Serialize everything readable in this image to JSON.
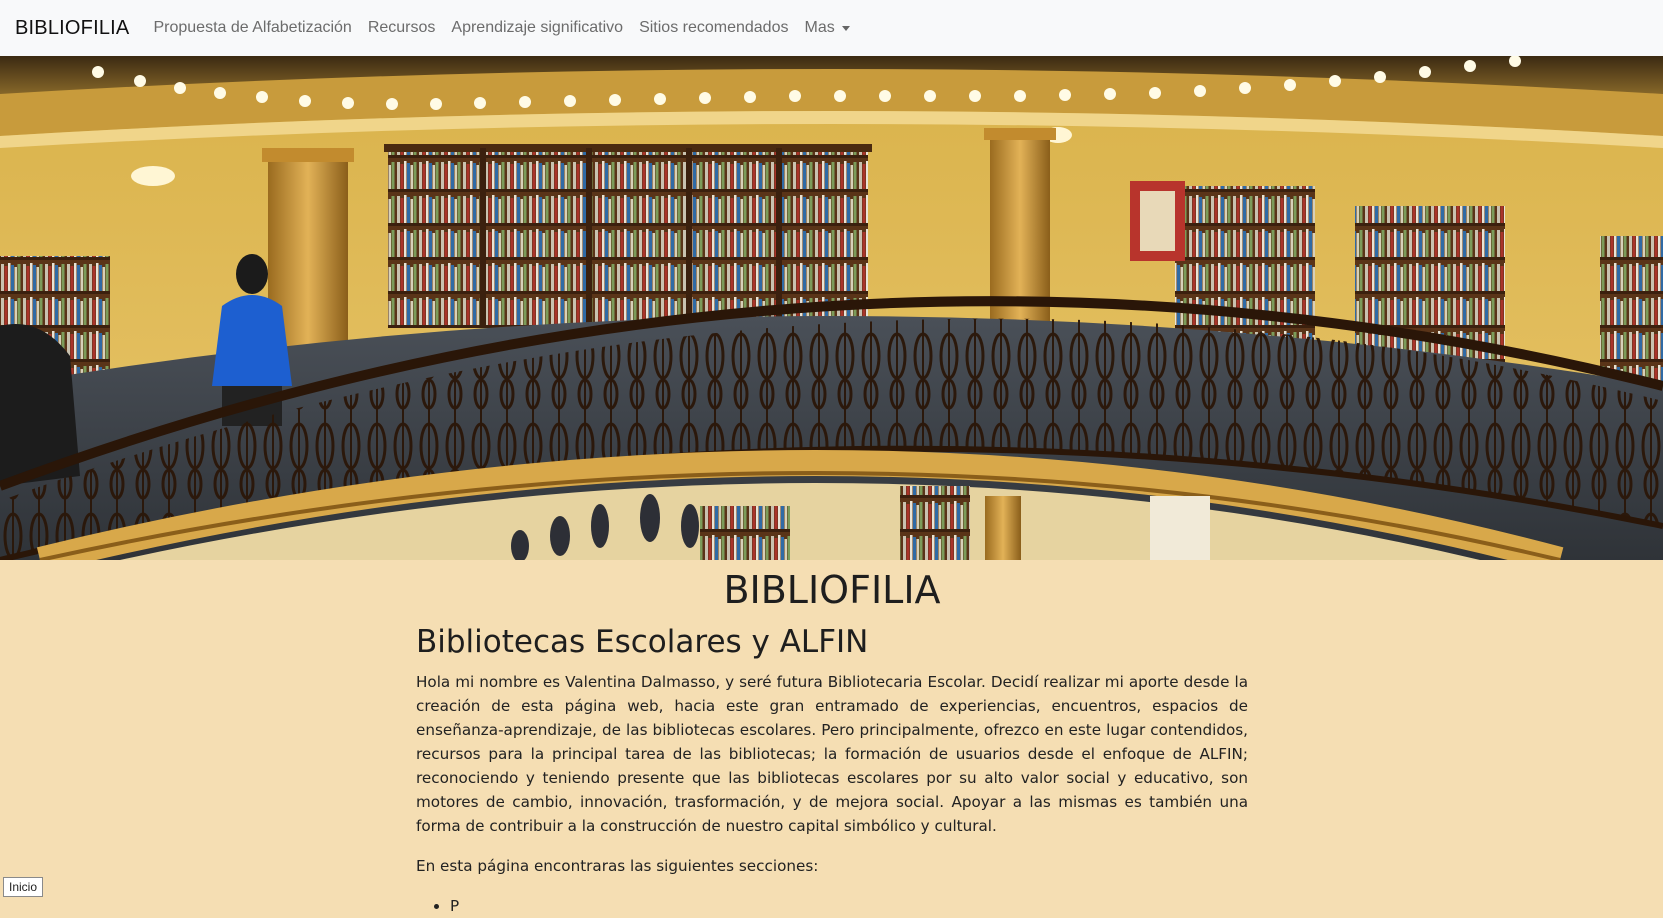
{
  "navbar": {
    "brand": "BIBLIOFILIA",
    "items": [
      {
        "label": "Propuesta de Alfabetización"
      },
      {
        "label": "Recursos"
      },
      {
        "label": "Aprendizaje significativo"
      },
      {
        "label": "Sitios recomendados"
      },
      {
        "label": "Mas",
        "dropdown": true
      }
    ]
  },
  "hero": {
    "alt": "Interior de librería con balcón circular y estanterías de libros"
  },
  "main": {
    "title": "BIBLIOFILIA",
    "subtitle": "Bibliotecas Escolares y ALFIN",
    "intro": "Hola mi nombre es Valentina Dalmasso, y seré futura Bibliotecaria Escolar. Decidí realizar mi aporte desde la creación de esta página web, hacia este gran entramado de experiencias, encuentros, espacios de enseñanza-aprendizaje, de las bibliotecas escolares. Pero principalmente, ofrezco en este lugar contendidos, recursos para la principal tarea de las bibliotecas; la formación de usuarios desde el enfoque de ALFIN; reconociendo y teniendo presente que las bibliotecas escolares por su alto valor social y educativo, son motores de cambio, innovación, trasformación, y de mejora social. Apoyar a las mismas es también una forma de contribuir a la construcción de nuestro capital simbólico y cultural.",
    "sections_lead": "En esta página encontraras las siguientes secciones:",
    "first_list_item_partial": "P"
  },
  "footer_link": {
    "label": "Inicio"
  },
  "colors": {
    "page_bg": "#f5deb3",
    "navbar_bg": "#f8f9fa",
    "nav_link": "#6c6c6c"
  }
}
